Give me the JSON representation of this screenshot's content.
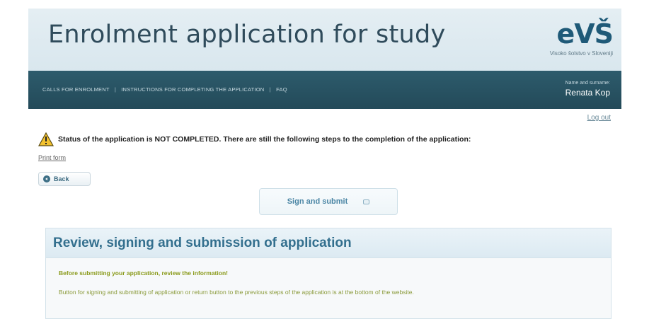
{
  "header": {
    "title": "Enrolment application for study",
    "logo_mark": "eVŠ",
    "logo_subtitle": "Visoko šolstvo v Sloveniji"
  },
  "nav": {
    "links": [
      {
        "label": "CALLS FOR ENROLMENT"
      },
      {
        "label": "INSTRUCTIONS FOR COMPLETING THE APPLICATION"
      },
      {
        "label": "FAQ"
      }
    ],
    "separator": "|",
    "user_caption": "Name and surname:",
    "user_name": "Renata Kop",
    "logout_label": "Log out"
  },
  "status": {
    "message": "Status of the application is NOT COMPLETED. There are still the following steps to the completion of the application:",
    "print_form_label": "Print form"
  },
  "actions": {
    "back_label": "Back",
    "sign_submit_label": "Sign and submit"
  },
  "panel": {
    "title": "Review, signing and submission of application",
    "notice": "Before submitting your application, review the information!",
    "text": "Button for signing and submitting of application or return button to the previous steps of the application is at the bottom of the website."
  },
  "colors": {
    "navbar": "#234a59",
    "title": "#2f4b5b",
    "logo": "#1f5a78",
    "panel_title": "#336f8e",
    "notice": "#8a9a1a",
    "warning": "#f2c12e"
  },
  "icons": {
    "status": "warning-triangle-icon",
    "back": "back-arrow-circle-icon",
    "sign": "envelope-icon"
  }
}
